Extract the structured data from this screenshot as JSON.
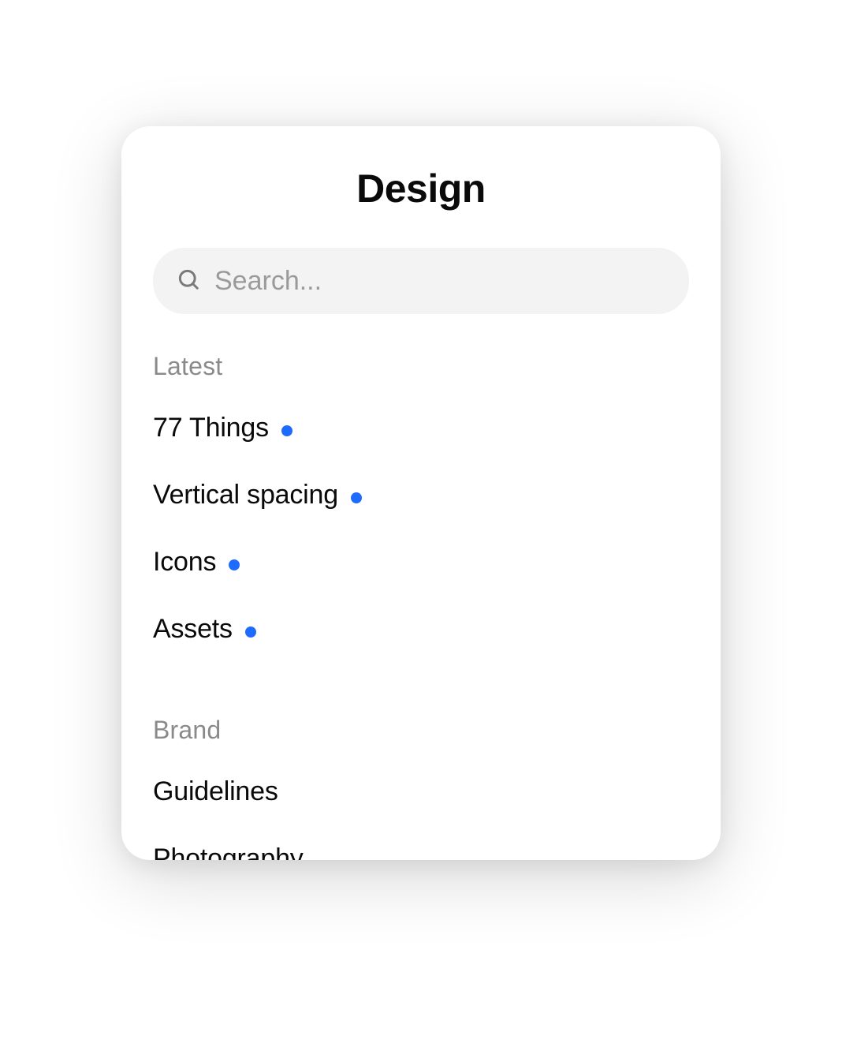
{
  "title": "Design",
  "search": {
    "placeholder": "Search...",
    "value": ""
  },
  "accent_color": "#1e6cff",
  "sections": [
    {
      "heading": "Latest",
      "items": [
        {
          "label": "77 Things",
          "dot": true
        },
        {
          "label": "Vertical spacing",
          "dot": true
        },
        {
          "label": "Icons",
          "dot": true
        },
        {
          "label": "Assets",
          "dot": true
        }
      ]
    },
    {
      "heading": "Brand",
      "items": [
        {
          "label": "Guidelines",
          "dot": false
        },
        {
          "label": "Photography",
          "dot": false
        }
      ]
    }
  ]
}
